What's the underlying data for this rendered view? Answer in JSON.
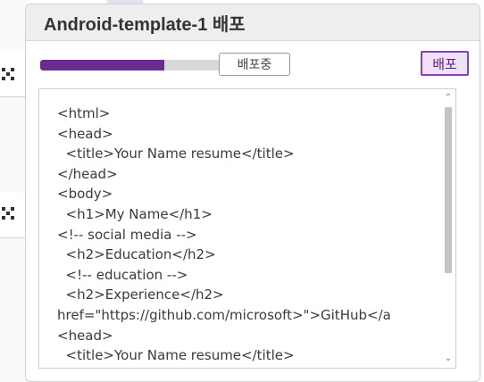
{
  "dialog": {
    "title": "Android-template-1 배포",
    "progress_fraction": 0.65,
    "status_label": "배포중",
    "deploy_label": "배포"
  },
  "code": {
    "lines": [
      "<html>",
      "<head>",
      "  <title>Your Name resume</title>",
      "</head>",
      "<body>",
      "  <h1>My Name</h1>",
      "<!-- social media -->",
      "  <h2>Education</h2>",
      "  <!-- education -->",
      "  <h2>Experience</h2>",
      "href=\"https://github.com/microsoft>\">GitHub</a",
      "<head>",
      "  <title>Your Name resume</title>"
    ]
  },
  "scrollbar": {
    "up_icon": "chevron-up-icon",
    "down_icon": "chevron-down-icon"
  },
  "colors": {
    "accent": "#6a2c91",
    "deploy_bg": "#efe2f8",
    "deploy_border": "#8a3fbf"
  },
  "icons": {
    "background_row_icon": "qr-code-icon"
  }
}
